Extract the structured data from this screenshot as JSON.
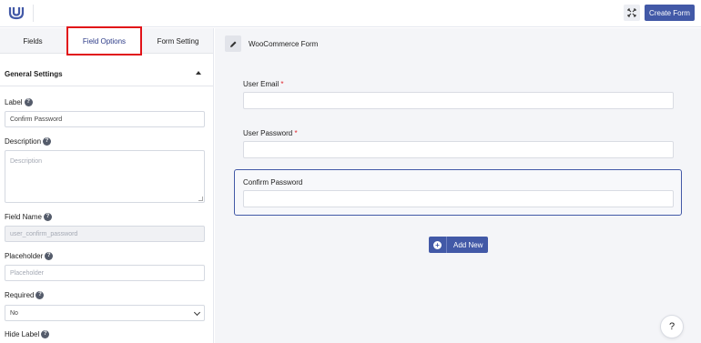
{
  "header": {
    "create_form_label": "Create Form",
    "logo_icon": "ur-logo-icon",
    "expand_icon": "expand-icon"
  },
  "sidebar": {
    "tabs": [
      {
        "label": "Fields"
      },
      {
        "label": "Field Options"
      },
      {
        "label": "Form Setting"
      }
    ],
    "active_tab": "Field Options",
    "section_title": "General Settings",
    "fields": {
      "label": {
        "label": "Label",
        "value": "Confirm Password"
      },
      "description": {
        "label": "Description",
        "placeholder": "Description"
      },
      "field_name": {
        "label": "Field Name",
        "value": "user_confirm_password"
      },
      "placeholder": {
        "label": "Placeholder",
        "placeholder": "Placeholder"
      },
      "required": {
        "label": "Required",
        "value": "No"
      },
      "hide_label": {
        "label": "Hide Label"
      }
    }
  },
  "main": {
    "form_title": "WooCommerce Form",
    "fields": [
      {
        "label": "User Email",
        "required": "*"
      },
      {
        "label": "User Password",
        "required": "*"
      },
      {
        "label": "Confirm Password",
        "required": ""
      }
    ],
    "add_new_label": "Add New",
    "help_label": "?"
  },
  "colors": {
    "accent": "#4259a7",
    "highlight_border": "#e11218",
    "required": "#e0262d"
  }
}
